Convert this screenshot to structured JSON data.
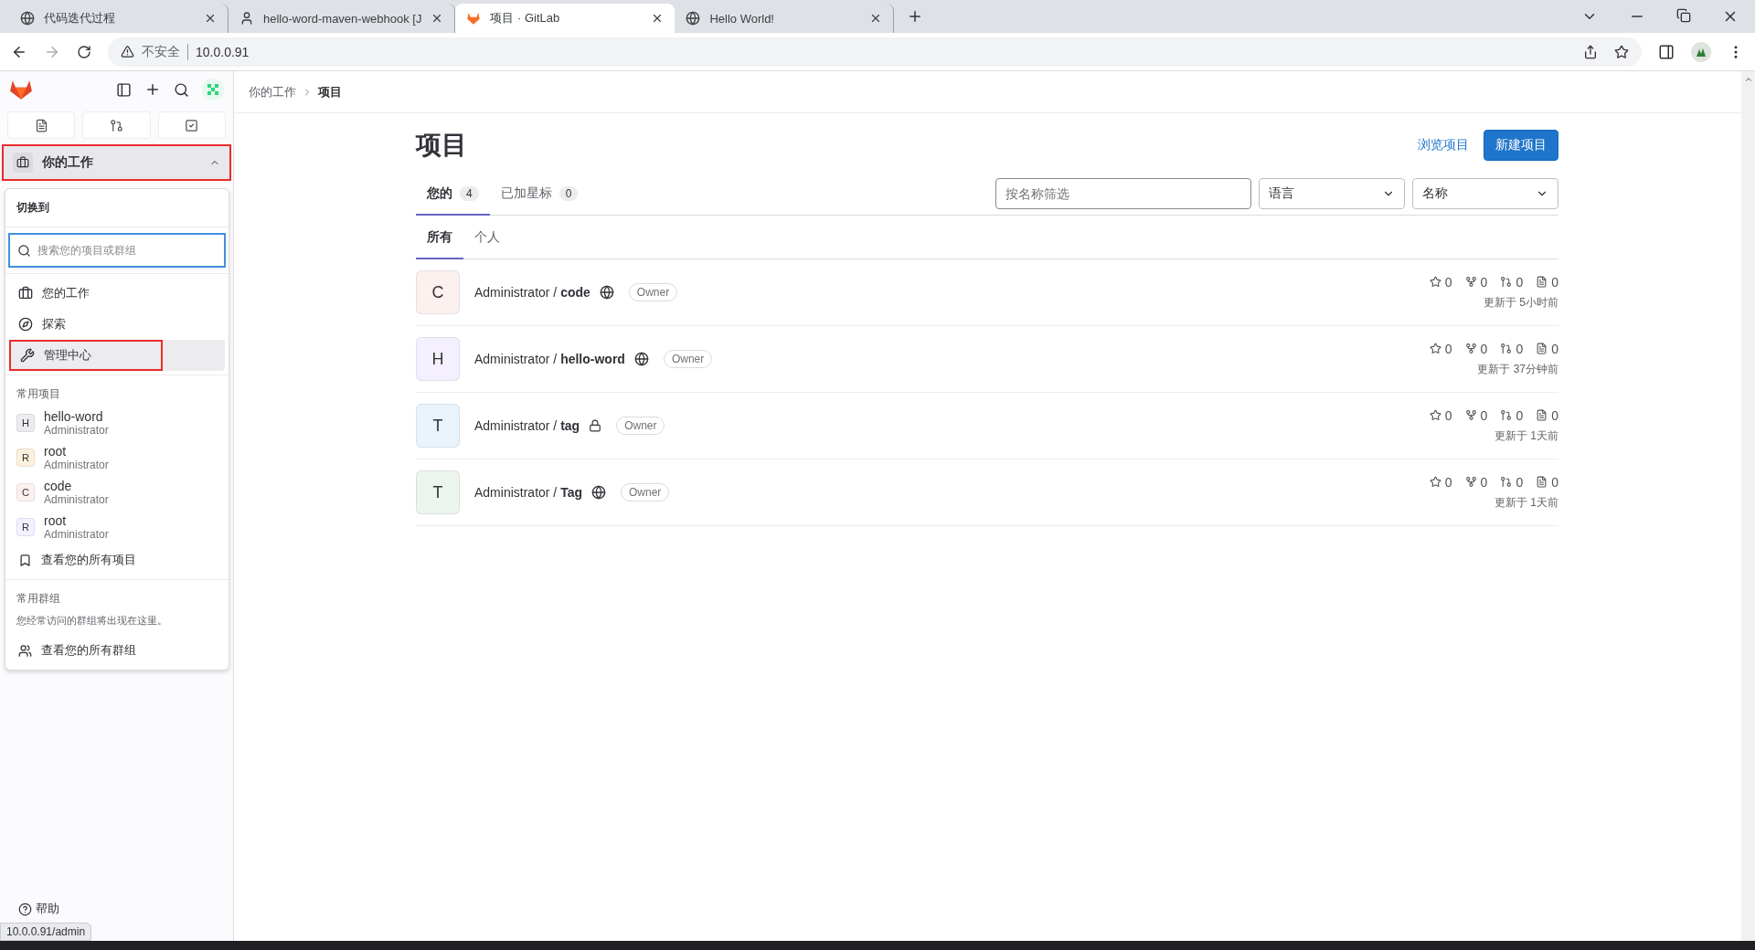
{
  "browser": {
    "tabs": [
      {
        "title": "代码迭代过程",
        "selected": false
      },
      {
        "title": "hello-word-maven-webhook [J",
        "selected": false
      },
      {
        "title": "项目 · GitLab",
        "selected": true
      },
      {
        "title": "Hello World!",
        "selected": false
      }
    ],
    "security": "不安全",
    "url": "10.0.0.91"
  },
  "sidebar": {
    "context": {
      "label": "你的工作",
      "highlighted": true
    },
    "switcher": {
      "title": "切换到",
      "search_placeholder": "搜索您的项目或群组",
      "nav": [
        {
          "label": "您的工作",
          "highlighted": false,
          "hovered": false
        },
        {
          "label": "探索",
          "highlighted": false,
          "hovered": false
        },
        {
          "label": "管理中心",
          "highlighted": true,
          "hovered": true
        }
      ],
      "projects_heading": "常用项目",
      "projects": [
        {
          "letter": "H",
          "name": "hello-word",
          "namespace": "Administrator",
          "color": "#ececef"
        },
        {
          "letter": "R",
          "name": "root",
          "namespace": "Administrator",
          "color": "#fdf1dd"
        },
        {
          "letter": "C",
          "name": "code",
          "namespace": "Administrator",
          "color": "#fcf1ef"
        },
        {
          "letter": "R",
          "name": "root",
          "namespace": "Administrator",
          "color": "#f4f0ff"
        }
      ],
      "all_projects": "查看您的所有项目",
      "groups_heading": "常用群组",
      "groups_empty": "您经常访问的群组将出现在这里。",
      "all_groups": "查看您的所有群组"
    },
    "help": "帮助",
    "status_url": "10.0.0.91/admin"
  },
  "breadcrumb": [
    "你的工作",
    "项目"
  ],
  "page": {
    "title": "项目",
    "browse": "浏览项目",
    "new_project": "新建项目",
    "tabs": [
      {
        "label": "您的",
        "count": "4",
        "selected": true
      },
      {
        "label": "已加星标",
        "count": "0",
        "selected": false
      }
    ],
    "filter_placeholder": "按名称筛选",
    "language": "语言",
    "sort": "名称",
    "subtabs": [
      {
        "label": "所有",
        "selected": true
      },
      {
        "label": "个人",
        "selected": false
      }
    ],
    "projects": [
      {
        "letter": "C",
        "color": "#fcf1ef",
        "namespace": "Administrator /",
        "name": "code",
        "private": false,
        "role": "Owner",
        "stars": "0",
        "forks": "0",
        "mrs": "0",
        "issues": "0",
        "updated": "更新于 5小时前"
      },
      {
        "letter": "H",
        "color": "#f4f0ff",
        "namespace": "Administrator /",
        "name": "hello-word",
        "private": false,
        "role": "Owner",
        "stars": "0",
        "forks": "0",
        "mrs": "0",
        "issues": "0",
        "updated": "更新于 37分钟前"
      },
      {
        "letter": "T",
        "color": "#e9f3fc",
        "namespace": "Administrator /",
        "name": "tag",
        "private": true,
        "role": "Owner",
        "stars": "0",
        "forks": "0",
        "mrs": "0",
        "issues": "0",
        "updated": "更新于 1天前"
      },
      {
        "letter": "T",
        "color": "#ecf4ee",
        "namespace": "Administrator /",
        "name": "Tag",
        "private": false,
        "role": "Owner",
        "stars": "0",
        "forks": "0",
        "mrs": "0",
        "issues": "0",
        "updated": "更新于 1天前"
      }
    ]
  }
}
